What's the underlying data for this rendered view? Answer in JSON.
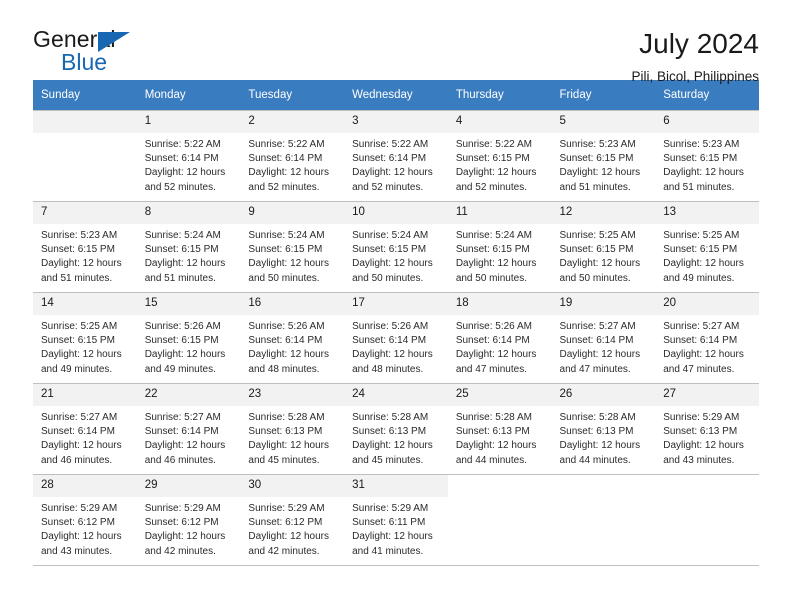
{
  "brand": {
    "name_part1": "General",
    "name_part2": "Blue",
    "flag_icon": "triangle-flag-icon"
  },
  "header": {
    "title": "July 2024",
    "location": "Pili, Bicol, Philippines"
  },
  "weekday_headers": [
    "Sunday",
    "Monday",
    "Tuesday",
    "Wednesday",
    "Thursday",
    "Friday",
    "Saturday"
  ],
  "colors": {
    "header_blue": "#3a7cc0",
    "brand_blue": "#1767b2",
    "daynum_bg": "#f2f2f2",
    "grid_line": "#bfbfbf"
  },
  "labels": {
    "sunrise_prefix": "Sunrise:",
    "sunset_prefix": "Sunset:",
    "daylight_prefix": "Daylight:"
  },
  "weeks": [
    [
      {
        "day": "",
        "empty": true
      },
      {
        "day": "1",
        "sunrise": "Sunrise: 5:22 AM",
        "sunset": "Sunset: 6:14 PM",
        "daylight1": "Daylight: 12 hours",
        "daylight2": "and 52 minutes."
      },
      {
        "day": "2",
        "sunrise": "Sunrise: 5:22 AM",
        "sunset": "Sunset: 6:14 PM",
        "daylight1": "Daylight: 12 hours",
        "daylight2": "and 52 minutes."
      },
      {
        "day": "3",
        "sunrise": "Sunrise: 5:22 AM",
        "sunset": "Sunset: 6:14 PM",
        "daylight1": "Daylight: 12 hours",
        "daylight2": "and 52 minutes."
      },
      {
        "day": "4",
        "sunrise": "Sunrise: 5:22 AM",
        "sunset": "Sunset: 6:15 PM",
        "daylight1": "Daylight: 12 hours",
        "daylight2": "and 52 minutes."
      },
      {
        "day": "5",
        "sunrise": "Sunrise: 5:23 AM",
        "sunset": "Sunset: 6:15 PM",
        "daylight1": "Daylight: 12 hours",
        "daylight2": "and 51 minutes."
      },
      {
        "day": "6",
        "sunrise": "Sunrise: 5:23 AM",
        "sunset": "Sunset: 6:15 PM",
        "daylight1": "Daylight: 12 hours",
        "daylight2": "and 51 minutes."
      }
    ],
    [
      {
        "day": "7",
        "sunrise": "Sunrise: 5:23 AM",
        "sunset": "Sunset: 6:15 PM",
        "daylight1": "Daylight: 12 hours",
        "daylight2": "and 51 minutes."
      },
      {
        "day": "8",
        "sunrise": "Sunrise: 5:24 AM",
        "sunset": "Sunset: 6:15 PM",
        "daylight1": "Daylight: 12 hours",
        "daylight2": "and 51 minutes."
      },
      {
        "day": "9",
        "sunrise": "Sunrise: 5:24 AM",
        "sunset": "Sunset: 6:15 PM",
        "daylight1": "Daylight: 12 hours",
        "daylight2": "and 50 minutes."
      },
      {
        "day": "10",
        "sunrise": "Sunrise: 5:24 AM",
        "sunset": "Sunset: 6:15 PM",
        "daylight1": "Daylight: 12 hours",
        "daylight2": "and 50 minutes."
      },
      {
        "day": "11",
        "sunrise": "Sunrise: 5:24 AM",
        "sunset": "Sunset: 6:15 PM",
        "daylight1": "Daylight: 12 hours",
        "daylight2": "and 50 minutes."
      },
      {
        "day": "12",
        "sunrise": "Sunrise: 5:25 AM",
        "sunset": "Sunset: 6:15 PM",
        "daylight1": "Daylight: 12 hours",
        "daylight2": "and 50 minutes."
      },
      {
        "day": "13",
        "sunrise": "Sunrise: 5:25 AM",
        "sunset": "Sunset: 6:15 PM",
        "daylight1": "Daylight: 12 hours",
        "daylight2": "and 49 minutes."
      }
    ],
    [
      {
        "day": "14",
        "sunrise": "Sunrise: 5:25 AM",
        "sunset": "Sunset: 6:15 PM",
        "daylight1": "Daylight: 12 hours",
        "daylight2": "and 49 minutes."
      },
      {
        "day": "15",
        "sunrise": "Sunrise: 5:26 AM",
        "sunset": "Sunset: 6:15 PM",
        "daylight1": "Daylight: 12 hours",
        "daylight2": "and 49 minutes."
      },
      {
        "day": "16",
        "sunrise": "Sunrise: 5:26 AM",
        "sunset": "Sunset: 6:14 PM",
        "daylight1": "Daylight: 12 hours",
        "daylight2": "and 48 minutes."
      },
      {
        "day": "17",
        "sunrise": "Sunrise: 5:26 AM",
        "sunset": "Sunset: 6:14 PM",
        "daylight1": "Daylight: 12 hours",
        "daylight2": "and 48 minutes."
      },
      {
        "day": "18",
        "sunrise": "Sunrise: 5:26 AM",
        "sunset": "Sunset: 6:14 PM",
        "daylight1": "Daylight: 12 hours",
        "daylight2": "and 47 minutes."
      },
      {
        "day": "19",
        "sunrise": "Sunrise: 5:27 AM",
        "sunset": "Sunset: 6:14 PM",
        "daylight1": "Daylight: 12 hours",
        "daylight2": "and 47 minutes."
      },
      {
        "day": "20",
        "sunrise": "Sunrise: 5:27 AM",
        "sunset": "Sunset: 6:14 PM",
        "daylight1": "Daylight: 12 hours",
        "daylight2": "and 47 minutes."
      }
    ],
    [
      {
        "day": "21",
        "sunrise": "Sunrise: 5:27 AM",
        "sunset": "Sunset: 6:14 PM",
        "daylight1": "Daylight: 12 hours",
        "daylight2": "and 46 minutes."
      },
      {
        "day": "22",
        "sunrise": "Sunrise: 5:27 AM",
        "sunset": "Sunset: 6:14 PM",
        "daylight1": "Daylight: 12 hours",
        "daylight2": "and 46 minutes."
      },
      {
        "day": "23",
        "sunrise": "Sunrise: 5:28 AM",
        "sunset": "Sunset: 6:13 PM",
        "daylight1": "Daylight: 12 hours",
        "daylight2": "and 45 minutes."
      },
      {
        "day": "24",
        "sunrise": "Sunrise: 5:28 AM",
        "sunset": "Sunset: 6:13 PM",
        "daylight1": "Daylight: 12 hours",
        "daylight2": "and 45 minutes."
      },
      {
        "day": "25",
        "sunrise": "Sunrise: 5:28 AM",
        "sunset": "Sunset: 6:13 PM",
        "daylight1": "Daylight: 12 hours",
        "daylight2": "and 44 minutes."
      },
      {
        "day": "26",
        "sunrise": "Sunrise: 5:28 AM",
        "sunset": "Sunset: 6:13 PM",
        "daylight1": "Daylight: 12 hours",
        "daylight2": "and 44 minutes."
      },
      {
        "day": "27",
        "sunrise": "Sunrise: 5:29 AM",
        "sunset": "Sunset: 6:13 PM",
        "daylight1": "Daylight: 12 hours",
        "daylight2": "and 43 minutes."
      }
    ],
    [
      {
        "day": "28",
        "sunrise": "Sunrise: 5:29 AM",
        "sunset": "Sunset: 6:12 PM",
        "daylight1": "Daylight: 12 hours",
        "daylight2": "and 43 minutes."
      },
      {
        "day": "29",
        "sunrise": "Sunrise: 5:29 AM",
        "sunset": "Sunset: 6:12 PM",
        "daylight1": "Daylight: 12 hours",
        "daylight2": "and 42 minutes."
      },
      {
        "day": "30",
        "sunrise": "Sunrise: 5:29 AM",
        "sunset": "Sunset: 6:12 PM",
        "daylight1": "Daylight: 12 hours",
        "daylight2": "and 42 minutes."
      },
      {
        "day": "31",
        "sunrise": "Sunrise: 5:29 AM",
        "sunset": "Sunset: 6:11 PM",
        "daylight1": "Daylight: 12 hours",
        "daylight2": "and 41 minutes."
      },
      {
        "day": "",
        "blank": true
      },
      {
        "day": "",
        "blank": true
      },
      {
        "day": "",
        "blank": true
      }
    ]
  ]
}
